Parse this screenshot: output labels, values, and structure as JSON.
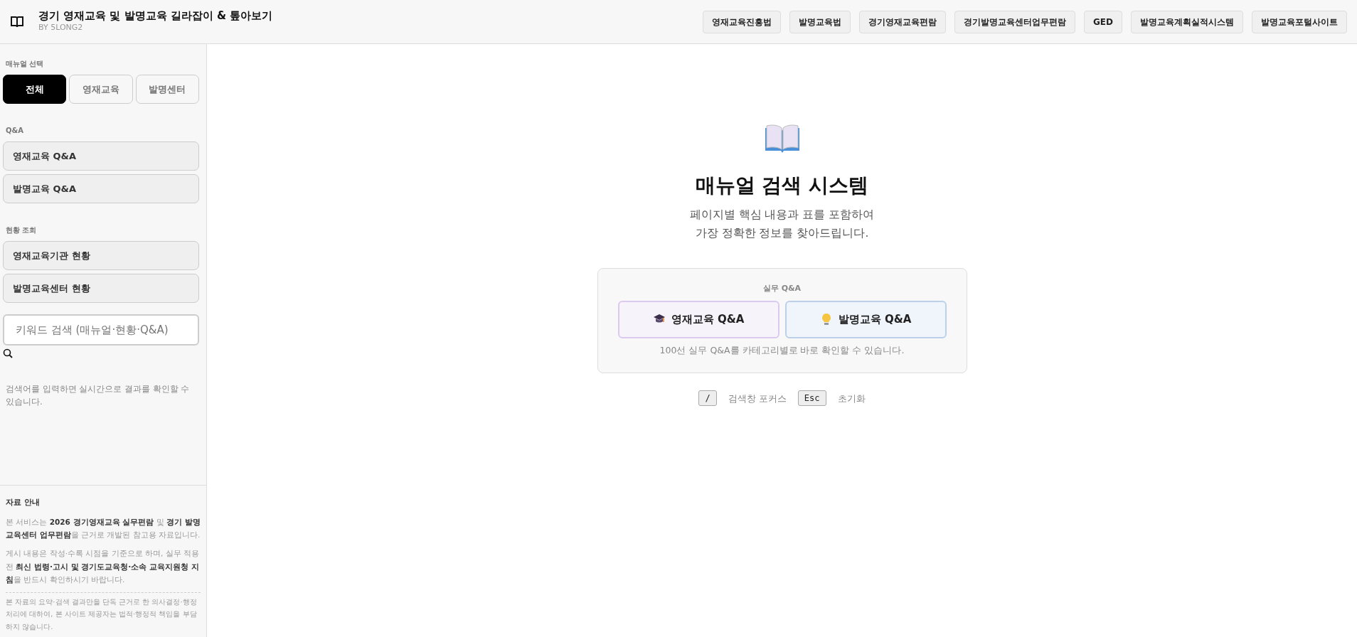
{
  "header": {
    "title": "경기 영재교육 및 발명교육 길라잡이 & 톺아보기",
    "subtitle": "BY 5LONG2",
    "links": [
      "영재교육진흥법",
      "발명교육법",
      "경기영재교육편람",
      "경기발명교육센터업무편람",
      "GED",
      "발명교육계획실적시스템",
      "발명교육포털사이트"
    ]
  },
  "sidebar": {
    "manual_label": "매뉴얼 선택",
    "filters": [
      {
        "label": "전체",
        "selected": true
      },
      {
        "label": "영재교육",
        "selected": false
      },
      {
        "label": "발명센터",
        "selected": false
      }
    ],
    "sections": [
      {
        "label": "Q&A",
        "items": [
          "영재교육 Q&A",
          "발명교육 Q&A"
        ]
      },
      {
        "label": "현황 조회",
        "items": [
          "영재교육기관 현황",
          "발명교육센터 현황"
        ]
      }
    ],
    "search": {
      "placeholder": "키워드 검색 (매뉴얼·현황·Q&A)"
    },
    "search_hint": "검색어를 입력하면 실시간으로 결과를 확인할 수 있습니다.",
    "notice": {
      "title": "자료 안내",
      "paragraphs": [
        "본 서비스는 **2026 경기영재교육 실무편람** 및 **경기 발명교육센터 업무편람**을 근거로 개발된 참고용 자료입니다.",
        "게시 내용은 작성·수록 시점을 기준으로 하며, 실무 적용 전 **최신 법령·고시 및 경기도교육청·소속 교육지원청 지침**을 반드시 확인하시기 바랍니다."
      ],
      "disclaimer": "본 자료의 요약·검색 결과만을 단독 근거로 한 의사결정·행정 처리에 대하여, 본 사이트 제공자는 법적·행정적 책임을 부담하지 않습니다."
    }
  },
  "main": {
    "title": "매뉴얼 검색 시스템",
    "subtitle_lines": [
      "페이지별 핵심 내용과 표를 포함하여",
      "가장 정확한 정보를 찾아드립니다."
    ],
    "qa_panel": {
      "label": "실무 Q&A",
      "buttons": [
        {
          "label": "영재교육 Q&A",
          "kind": "gifted"
        },
        {
          "label": "발명교육 Q&A",
          "kind": "invention"
        }
      ],
      "caption": "100선 실무 Q&A를 카테고리별로 바로 확인할 수 있습니다."
    },
    "shortcuts": [
      {
        "key": "/",
        "label": "검색창 포커스"
      },
      {
        "key": "Esc",
        "label": "초기화"
      }
    ]
  }
}
